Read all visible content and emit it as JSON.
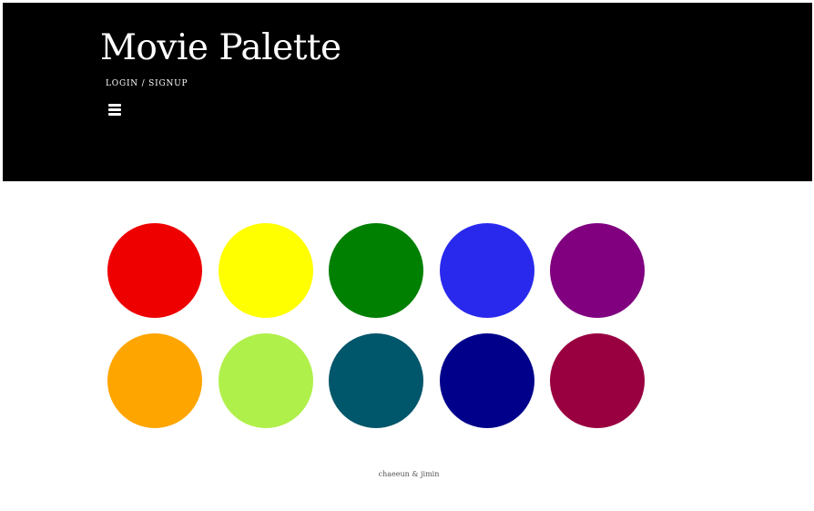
{
  "header": {
    "title": "Movie Palette",
    "login_label": "LOGIN / SIGNUP",
    "menu_icon": "hamburger-menu-icon",
    "background": "#000000"
  },
  "palette": {
    "colors": [
      "#ee0000",
      "#ffff00",
      "#008000",
      "#2929ee",
      "#800080",
      "#ffa500",
      "#b0f04b",
      "#00566a",
      "#00008b",
      "#990040"
    ]
  },
  "footer": {
    "credit": "chaeeun & jimin"
  }
}
